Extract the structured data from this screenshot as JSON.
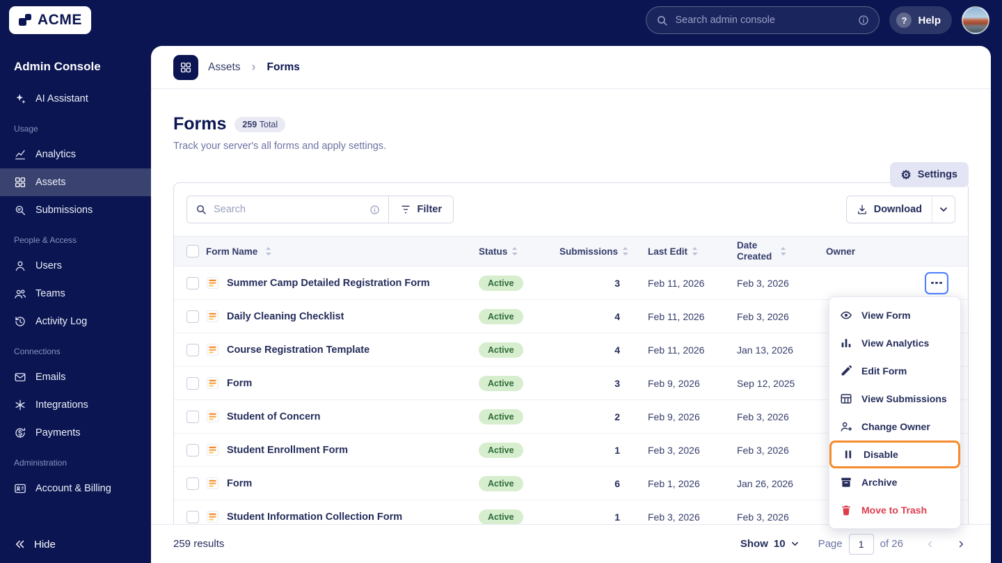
{
  "topbar": {
    "logo": "ACME",
    "search_placeholder": "Search admin console",
    "help_q": "?",
    "help": "Help"
  },
  "sidebar": {
    "title": "Admin Console",
    "assistant_label": "AI Assistant",
    "sections": [
      {
        "label": "Usage",
        "items": [
          {
            "label": "Analytics"
          },
          {
            "label": "Assets"
          },
          {
            "label": "Submissions"
          }
        ]
      },
      {
        "label": "People & Access",
        "items": [
          {
            "label": "Users"
          },
          {
            "label": "Teams"
          },
          {
            "label": "Activity Log"
          }
        ]
      },
      {
        "label": "Connections",
        "items": [
          {
            "label": "Emails"
          },
          {
            "label": "Integrations"
          },
          {
            "label": "Payments"
          }
        ]
      },
      {
        "label": "Administration",
        "items": [
          {
            "label": "Account & Billing"
          }
        ]
      }
    ],
    "hide": "Hide"
  },
  "breadcrumb": {
    "root": "Assets",
    "current": "Forms"
  },
  "page": {
    "title": "Forms",
    "badge_count": "259",
    "badge_label": "Total",
    "subtitle": "Track your server's all forms and apply settings.",
    "settings": "Settings"
  },
  "toolbar": {
    "search_placeholder": "Search",
    "filter": "Filter",
    "download": "Download"
  },
  "table": {
    "headers": [
      "Form Name",
      "Status",
      "Submissions",
      "Last Edit",
      "Date Created",
      "Owner"
    ],
    "rows": [
      {
        "name": "Summer Camp Detailed Registration Form",
        "status": "Active",
        "submissions": "3",
        "last_edit": "Feb 11, 2026",
        "date_created": "Feb 3, 2026"
      },
      {
        "name": "Daily Cleaning Checklist",
        "status": "Active",
        "submissions": "4",
        "last_edit": "Feb 11, 2026",
        "date_created": "Feb 3, 2026"
      },
      {
        "name": "Course Registration Template",
        "status": "Active",
        "submissions": "4",
        "last_edit": "Feb 11, 2026",
        "date_created": "Jan 13, 2026"
      },
      {
        "name": "Form",
        "status": "Active",
        "submissions": "3",
        "last_edit": "Feb 9, 2026",
        "date_created": "Sep 12, 2025"
      },
      {
        "name": "Student of Concern",
        "status": "Active",
        "submissions": "2",
        "last_edit": "Feb 9, 2026",
        "date_created": "Feb 3, 2026"
      },
      {
        "name": "Student Enrollment Form",
        "status": "Active",
        "submissions": "1",
        "last_edit": "Feb 3, 2026",
        "date_created": "Feb 3, 2026"
      },
      {
        "name": "Form",
        "status": "Active",
        "submissions": "6",
        "last_edit": "Feb 1, 2026",
        "date_created": "Jan 26, 2026"
      },
      {
        "name": "Student Information Collection Form",
        "status": "Active",
        "submissions": "1",
        "last_edit": "Feb 3, 2026",
        "date_created": "Feb 3, 2026"
      }
    ]
  },
  "menu": {
    "items": [
      {
        "label": "View Form"
      },
      {
        "label": "View Analytics"
      },
      {
        "label": "Edit Form"
      },
      {
        "label": "View Submissions"
      },
      {
        "label": "Change Owner"
      },
      {
        "label": "Disable"
      },
      {
        "label": "Archive"
      },
      {
        "label": "Move to Trash"
      }
    ]
  },
  "footer": {
    "results": "259 results",
    "show_label": "Show",
    "show_value": "10",
    "page_label": "Page",
    "page_value": "1",
    "of_label": "of 26"
  },
  "colors": {
    "navy": "#0a1551",
    "sidebar_active": "#3a4270",
    "highlight_orange": "#f68b2e",
    "danger_red": "#dc3d4d",
    "active_badge_bg": "#d6eecd",
    "active_badge_text": "#2e6b3a",
    "focus_blue": "#4a7dff"
  }
}
